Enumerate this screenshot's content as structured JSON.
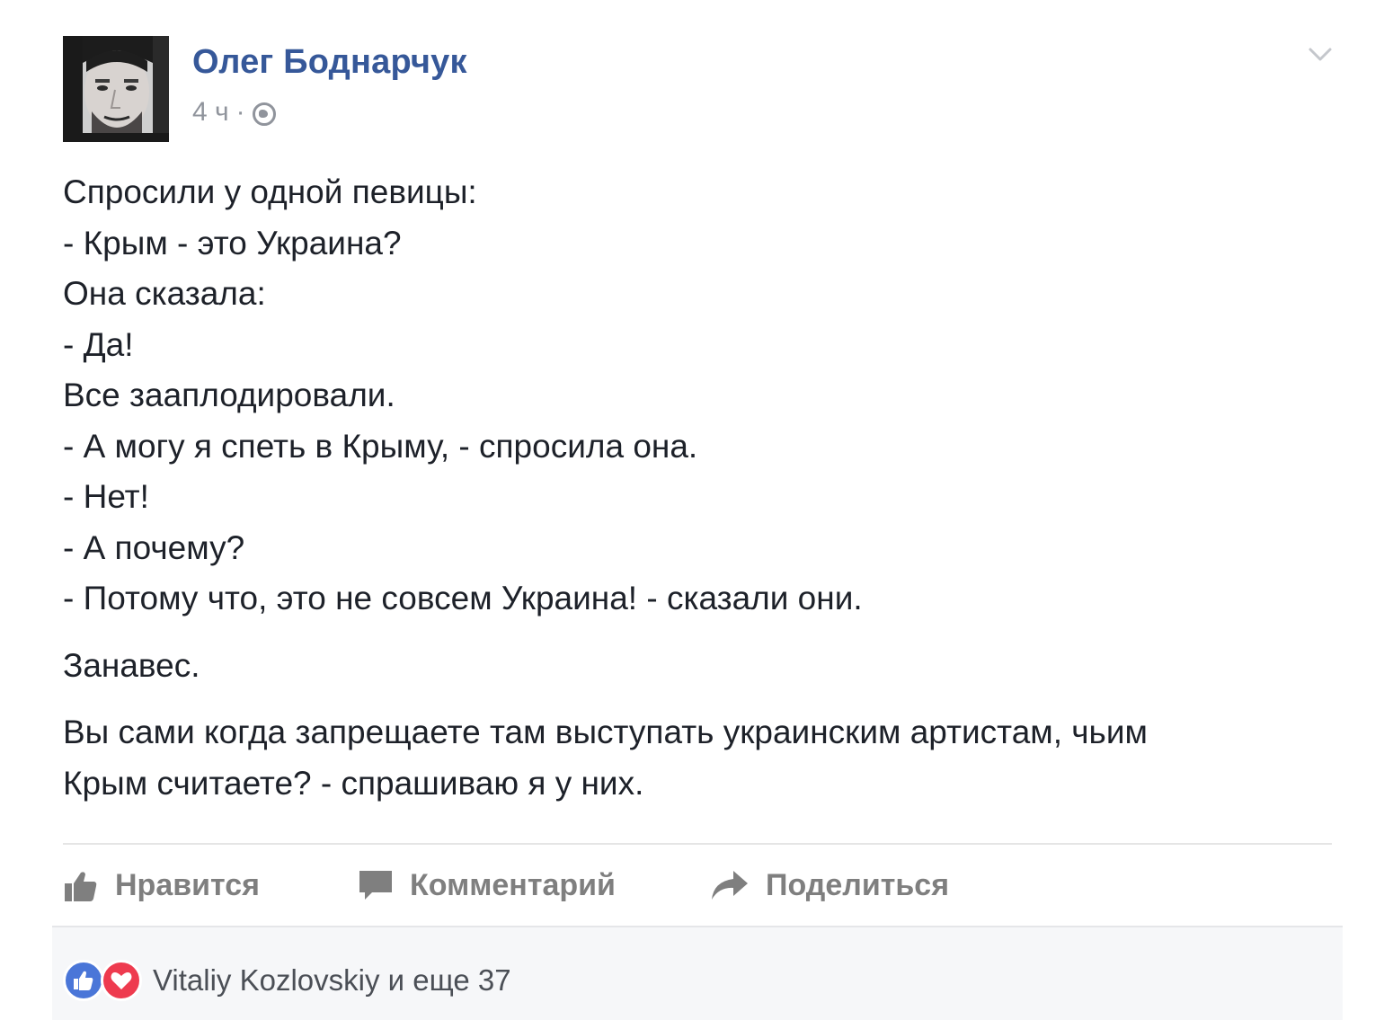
{
  "post": {
    "author": "Олег Боднарчук",
    "time": "4 ч",
    "separator": "·",
    "privacy_icon": "globe-icon",
    "menu_icon": "chevron-down-icon",
    "lines": [
      "Спросили у одной певицы:",
      "- Крым - это Украина?",
      "Она сказала:",
      "- Да!",
      "Все зааплодировали.",
      "- А могу я спеть в Крыму, - спросила она.",
      "- Нет!",
      "- А почему?",
      "- Потому что, это не совсем Украина! - сказали они."
    ],
    "paragraph2": "Занавес.",
    "paragraph3_line1": "Вы сами когда запрещаете там выступать украинским артистам, чьим",
    "paragraph3_line2": "Крым считаете? - спрашиваю я у них."
  },
  "actions": {
    "like_label": "Нравится",
    "comment_label": "Комментарий",
    "share_label": "Поделиться"
  },
  "reactions": {
    "icons": [
      "like-reaction-icon",
      "love-reaction-icon"
    ],
    "summary": "Vitaliy Kozlovskiy и еще 37"
  },
  "colors": {
    "author": "#365899",
    "meta": "#90949c",
    "text": "#1d2129",
    "action": "#7f7f7f",
    "like_reaction": "#4a76d8",
    "love_reaction": "#ee3b4f"
  }
}
